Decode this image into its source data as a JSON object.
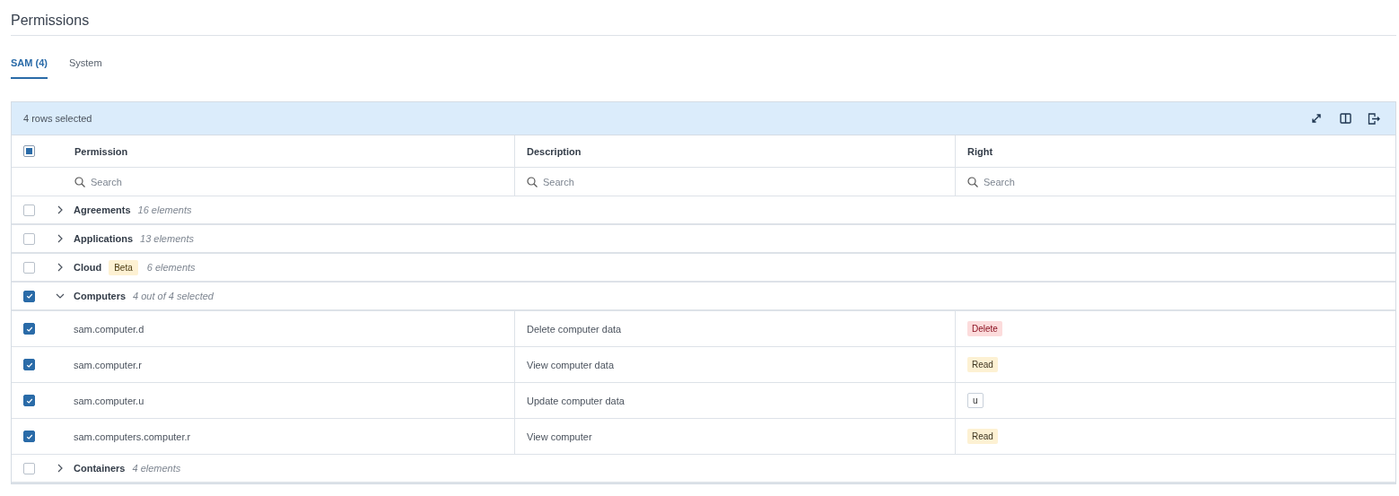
{
  "title": "Permissions",
  "tabs": [
    {
      "label": "SAM (4)",
      "selected": true
    },
    {
      "label": "System",
      "selected": false
    }
  ],
  "toolbar": {
    "selection_text": "4 rows selected"
  },
  "table": {
    "header_checkbox": {
      "indeterminate": true
    },
    "columns": [
      {
        "label": "Permission",
        "search_placeholder": "Search"
      },
      {
        "label": "Description",
        "search_placeholder": "Search"
      },
      {
        "label": "Right",
        "search_placeholder": "Search"
      }
    ],
    "groups": [
      {
        "name": "Agreements",
        "note": "16 elements",
        "checked": false,
        "expanded": false
      },
      {
        "name": "Applications",
        "note": "13 elements",
        "checked": false,
        "expanded": false
      },
      {
        "name": "Cloud",
        "badge": "Beta",
        "note": "6 elements",
        "checked": false,
        "expanded": false
      },
      {
        "name": "Computers",
        "note": "4 out of 4 selected",
        "checked": true,
        "expanded": true,
        "children": [
          {
            "permission": "sam.computer.d",
            "description": "Delete computer data",
            "right": {
              "label": "Delete",
              "kind": "delete"
            },
            "checked": true
          },
          {
            "permission": "sam.computer.r",
            "description": "View computer data",
            "right": {
              "label": "Read",
              "kind": "read"
            },
            "checked": true
          },
          {
            "permission": "sam.computer.u",
            "description": "Update computer data",
            "right": {
              "label": "u",
              "kind": "other"
            },
            "checked": true
          },
          {
            "permission": "sam.computers.computer.r",
            "description": "View computer",
            "right": {
              "label": "Read",
              "kind": "read"
            },
            "checked": true
          }
        ]
      },
      {
        "name": "Containers",
        "note": "4 elements",
        "checked": false,
        "expanded": false
      }
    ]
  }
}
